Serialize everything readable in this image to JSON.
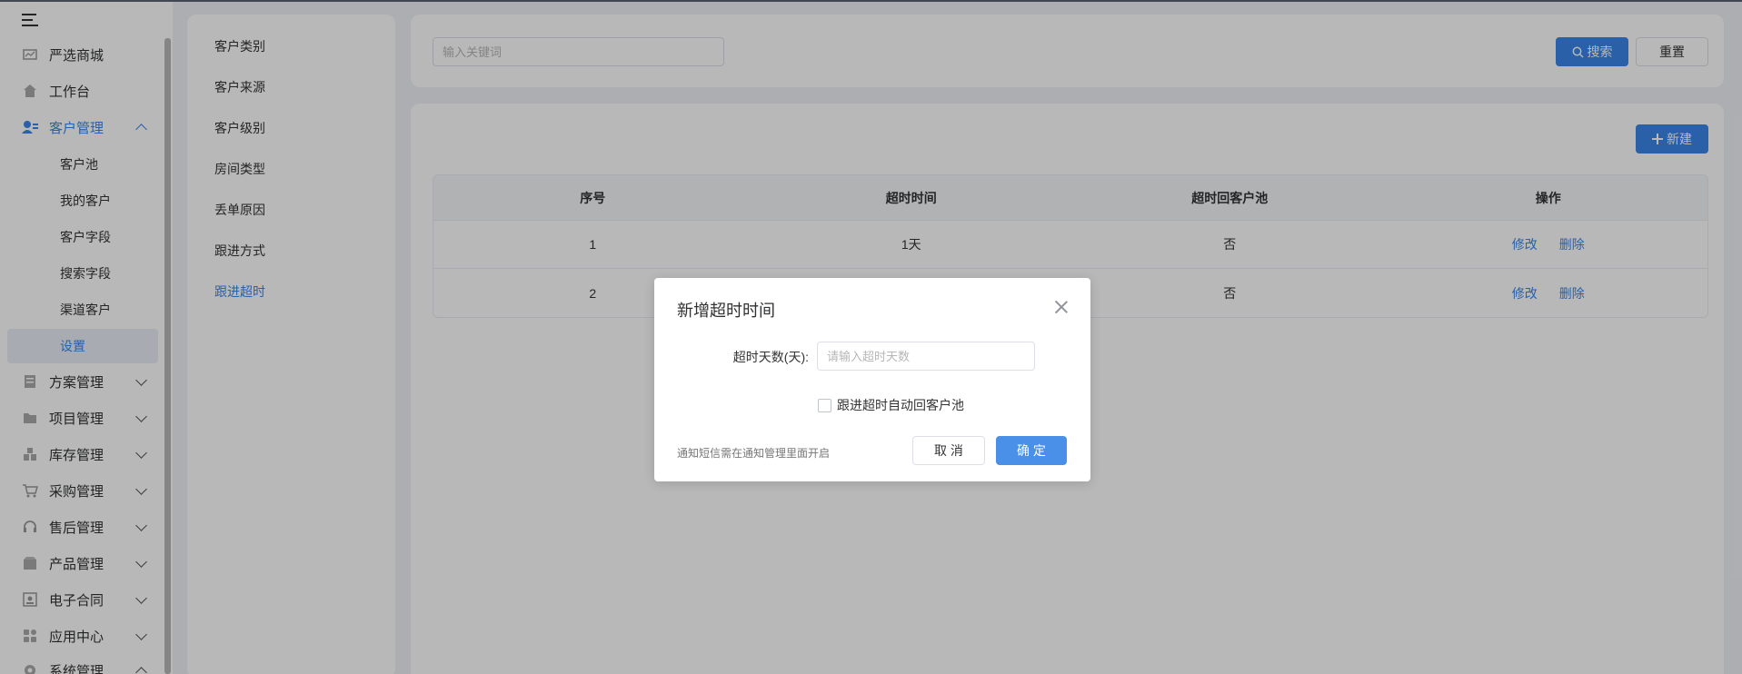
{
  "sidebar": {
    "items": [
      {
        "label": "严选商城",
        "icon": "mall-icon"
      },
      {
        "label": "工作台",
        "icon": "home-icon"
      },
      {
        "label": "客户管理",
        "icon": "customer-icon"
      },
      {
        "label": "方案管理",
        "icon": "document-icon"
      },
      {
        "label": "项目管理",
        "icon": "folder-icon"
      },
      {
        "label": "库存管理",
        "icon": "inventory-icon"
      },
      {
        "label": "采购管理",
        "icon": "cart-icon"
      },
      {
        "label": "售后管理",
        "icon": "headset-icon"
      },
      {
        "label": "产品管理",
        "icon": "box-icon"
      },
      {
        "label": "电子合同",
        "icon": "contract-icon"
      },
      {
        "label": "应用中心",
        "icon": "apps-icon"
      },
      {
        "label": "系统管理",
        "icon": "system-icon"
      }
    ],
    "sub_items": [
      "客户池",
      "我的客户",
      "客户字段",
      "搜索字段",
      "渠道客户",
      "设置"
    ]
  },
  "categories": [
    "客户类别",
    "客户来源",
    "客户级别",
    "房间类型",
    "丢单原因",
    "跟进方式",
    "跟进超时"
  ],
  "search": {
    "placeholder": "输入关键词",
    "search_label": "搜索",
    "reset_label": "重置"
  },
  "toolbar": {
    "new_label": "新建"
  },
  "table": {
    "headers": [
      "序号",
      "超时时间",
      "超时回客户池",
      "操作"
    ],
    "rows": [
      {
        "index": "1",
        "timeout": "1天",
        "back_to_pool": "否"
      },
      {
        "index": "2",
        "timeout": "",
        "back_to_pool": "否"
      }
    ],
    "edit_label": "修改",
    "delete_label": "删除"
  },
  "dialog": {
    "title": "新增超时时间",
    "field_label": "超时天数(天):",
    "field_placeholder": "请输入超时天数",
    "checkbox_label": "跟进超时自动回客户池",
    "note": "通知短信需在通知管理里面开启",
    "cancel_label": "取 消",
    "ok_label": "确 定"
  },
  "colors": {
    "accent": "#3a86e8",
    "mask": "rgba(0,0,0,0.28)"
  }
}
